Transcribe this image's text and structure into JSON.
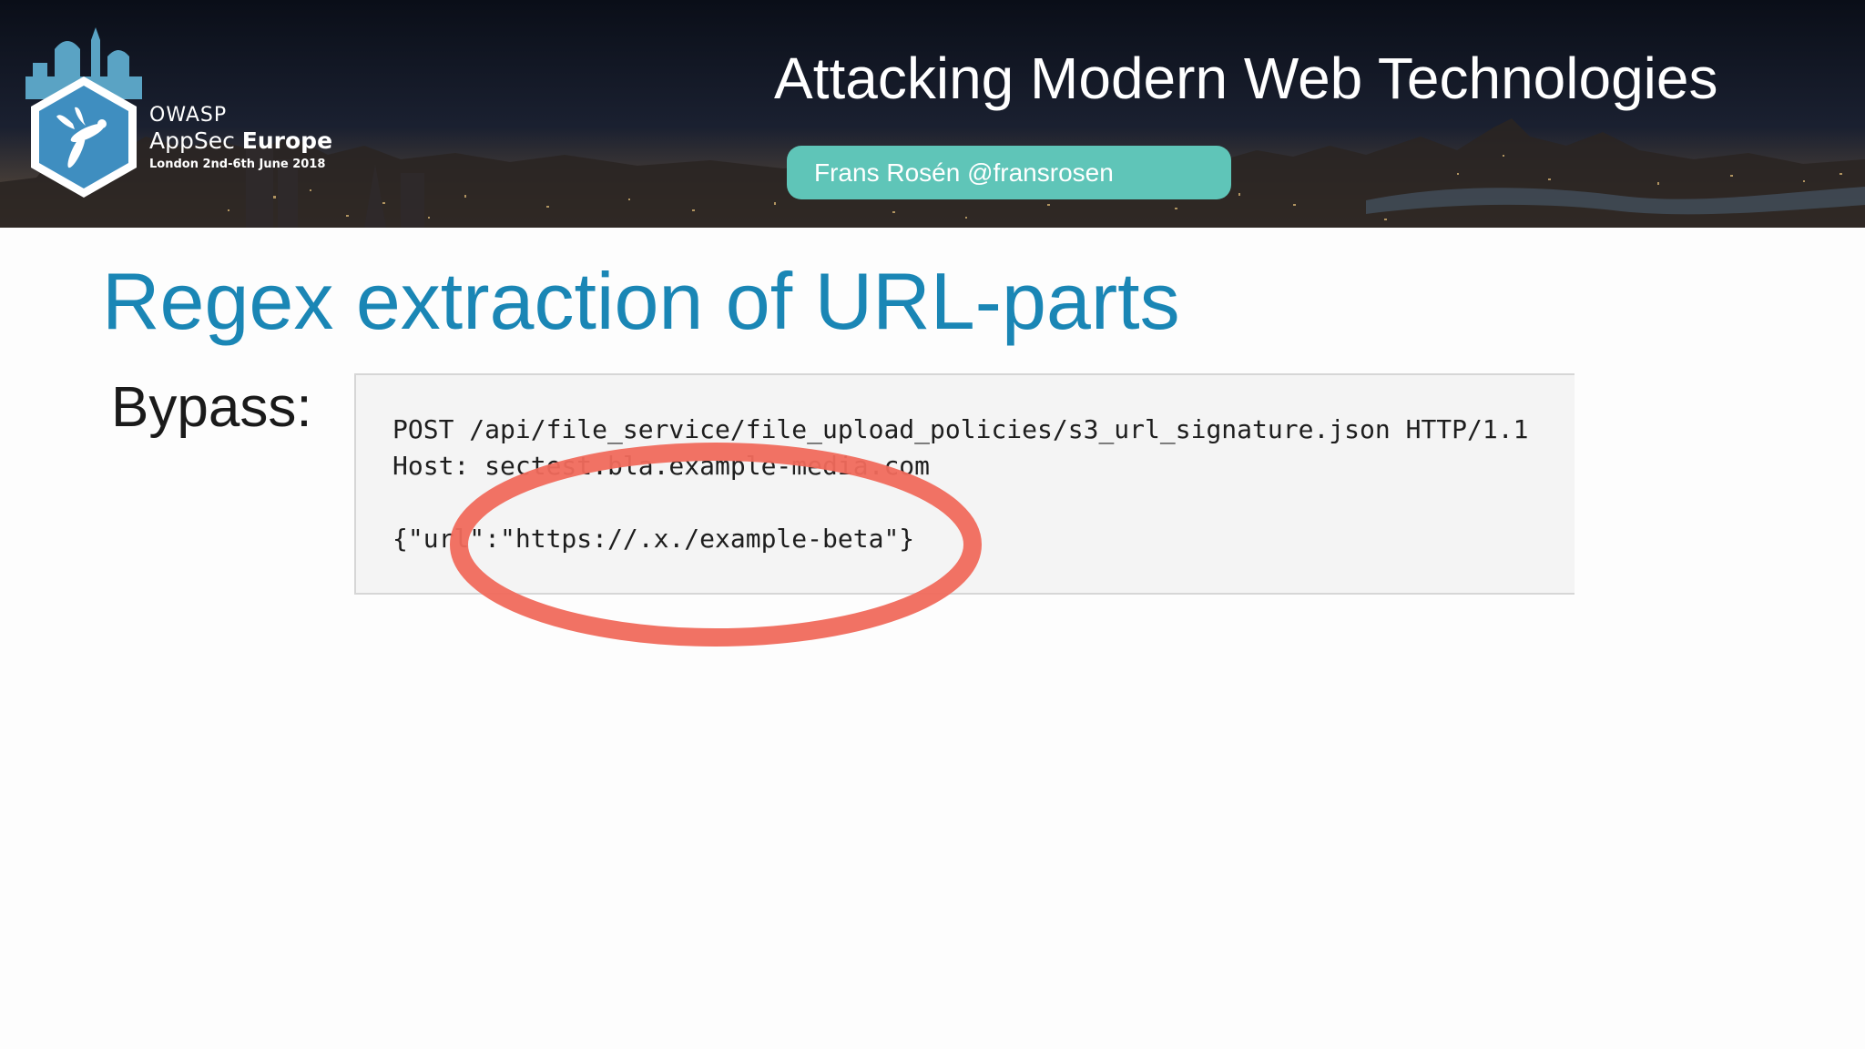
{
  "header": {
    "organization": "OWASP",
    "event_name_regular": "AppSec ",
    "event_name_bold": "Europe",
    "event_dates": "London 2nd-6th June 2018",
    "talk_title": "Attacking Modern Web Technologies",
    "speaker": "Frans Rosén @fransrosen",
    "speaker_pill_color": "#5fc5b8"
  },
  "slide": {
    "title": "Regex extraction of URL-parts",
    "title_color": "#1a86b5",
    "label": "Bypass:",
    "code": {
      "request_line": "POST /api/file_service/file_upload_policies/s3_url_signature.json HTTP/1.1",
      "host_line": "Host: sectest.bla.example-media.com",
      "blank_line": "",
      "body_line": "{\"url\":\"https://.x./example-beta\"}"
    },
    "annotation": {
      "shape": "ellipse",
      "color": "#f06a5c"
    }
  }
}
